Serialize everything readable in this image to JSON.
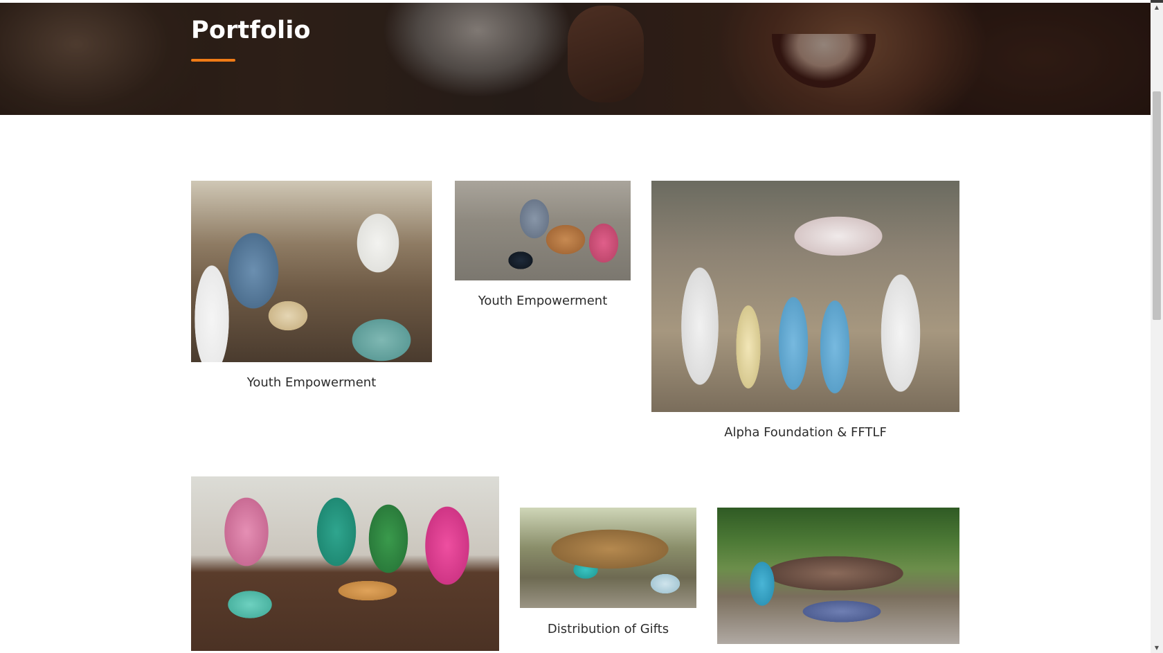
{
  "hero": {
    "title": "Portfolio",
    "accent_color": "#f07b16"
  },
  "portfolio": {
    "items": [
      {
        "caption": "Youth Empowerment",
        "image_desc": "women-cooking-photo"
      },
      {
        "caption": "Youth Empowerment",
        "image_desc": "youth-crafting-photo"
      },
      {
        "caption": "Alpha Foundation & FFTLF",
        "image_desc": "group-donation-photo"
      },
      {
        "caption": "",
        "image_desc": "girls-baking-photo"
      },
      {
        "caption": "Distribution of Gifts",
        "image_desc": "children-gifts-photo"
      },
      {
        "caption": "",
        "image_desc": "outdoor-distribution-photo"
      }
    ]
  },
  "scrollbar": {
    "up_arrow": "▲",
    "down_arrow": "▼"
  }
}
